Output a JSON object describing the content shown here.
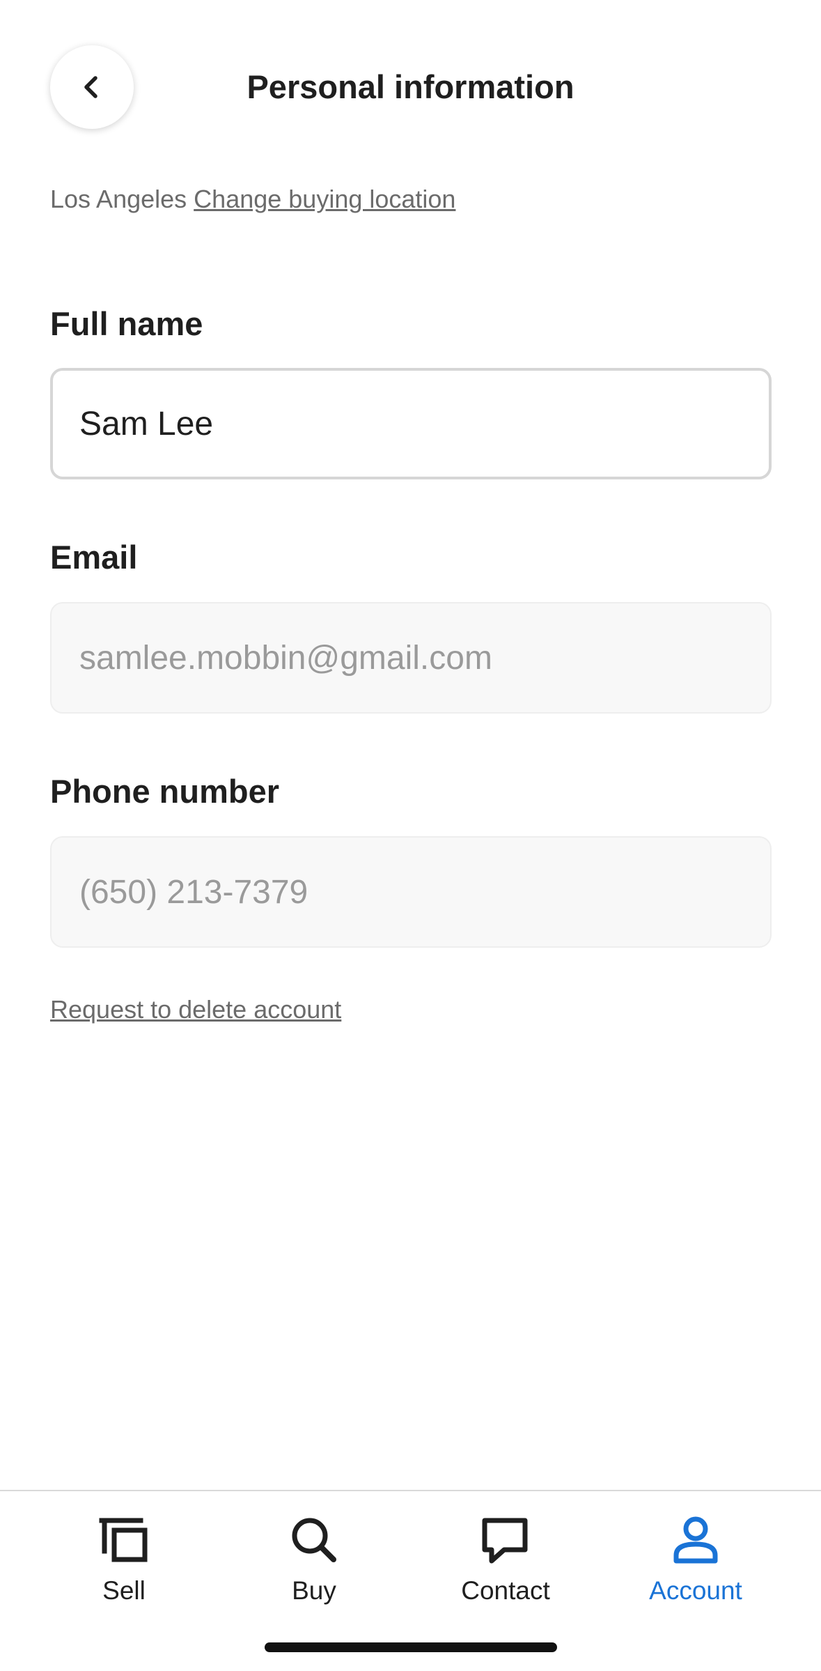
{
  "header": {
    "title": "Personal information",
    "back_icon": "chevron-left-icon"
  },
  "location": {
    "city": "Los Angeles",
    "change_link": "Change buying location"
  },
  "form": {
    "full_name": {
      "label": "Full name",
      "value": "Sam Lee"
    },
    "email": {
      "label": "Email",
      "value": "samlee.mobbin@gmail.com"
    },
    "phone": {
      "label": "Phone number",
      "value": "(650) 213-7379"
    }
  },
  "delete_link": "Request to delete account",
  "tabs": [
    {
      "label": "Sell",
      "icon": "layers-icon",
      "active": false
    },
    {
      "label": "Buy",
      "icon": "search-icon",
      "active": false
    },
    {
      "label": "Contact",
      "icon": "chat-bubble-icon",
      "active": false
    },
    {
      "label": "Account",
      "icon": "person-icon",
      "active": true
    }
  ],
  "colors": {
    "accent": "#1a73d6",
    "text": "#1f1f1f",
    "muted": "#6b6b6b",
    "disabled_text": "#9a9a9a"
  }
}
